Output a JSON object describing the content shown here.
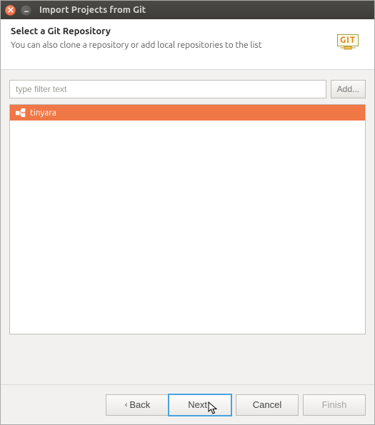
{
  "window": {
    "title": "Import Projects from Git"
  },
  "header": {
    "heading": "Select a Git Repository",
    "sub": "You can also clone a repository or add local repositories to the list",
    "logo_text": "GIT"
  },
  "filter": {
    "placeholder": "type filter text",
    "value": ""
  },
  "buttons": {
    "add": "Add..."
  },
  "repos": [
    {
      "name": "tinyara",
      "selected": true
    }
  ],
  "footer": {
    "back": "Back",
    "next": "Next",
    "cancel": "Cancel",
    "finish": "Finish"
  },
  "colors": {
    "selection": "#f07746",
    "focus": "#4aa3e0"
  }
}
